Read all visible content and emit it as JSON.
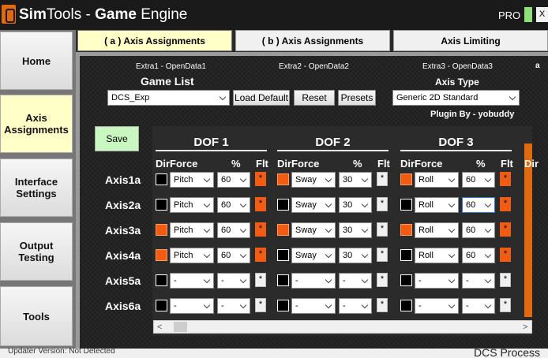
{
  "app": {
    "title_prefix": "Sim",
    "title_mid": "Tools - ",
    "title_bold": "Game",
    "title_suffix": " Engine",
    "pro_label": "PRO",
    "close_label": "X"
  },
  "sidebar": {
    "items": [
      {
        "label": "Home"
      },
      {
        "label": "Axis Assignments"
      },
      {
        "label": "Interface Settings"
      },
      {
        "label": "Output Testing"
      },
      {
        "label": "Tools"
      }
    ]
  },
  "tabs": [
    {
      "label": "( a ) Axis Assignments"
    },
    {
      "label": "( b ) Axis Assignments"
    },
    {
      "label": "Axis Limiting"
    }
  ],
  "extras": {
    "extra1": "Extra1 - OpenData1",
    "extra2": "Extra2 - OpenData2",
    "extra3": "Extra3 - OpenData3",
    "corner": "a"
  },
  "game_list": {
    "label": "Game List",
    "selected": "DCS_Exp",
    "load_default": "Load Default",
    "reset": "Reset",
    "presets": "Presets"
  },
  "axis_type": {
    "label": "Axis Type",
    "selected": "Generic 2D Standard"
  },
  "plugin_by": "Plugin By - yobuddy",
  "save_label": "Save",
  "columns": {
    "dir": "Dir",
    "force": "Force",
    "percent": "%",
    "flt": "Flt"
  },
  "dof": [
    {
      "title": "DOF 1",
      "rows": [
        {
          "dir_on": false,
          "force": "Pitch",
          "percent": "60",
          "flt": "*",
          "flt_on": true
        },
        {
          "dir_on": false,
          "force": "Pitch",
          "percent": "60",
          "flt": "*",
          "flt_on": true
        },
        {
          "dir_on": true,
          "force": "Pitch",
          "percent": "60",
          "flt": "*",
          "flt_on": true
        },
        {
          "dir_on": true,
          "force": "Pitch",
          "percent": "60",
          "flt": "*",
          "flt_on": true
        },
        {
          "dir_on": false,
          "force": "-",
          "percent": "-",
          "flt": "*",
          "flt_on": false
        },
        {
          "dir_on": false,
          "force": "-",
          "percent": "-",
          "flt": "*",
          "flt_on": false
        }
      ]
    },
    {
      "title": "DOF 2",
      "rows": [
        {
          "dir_on": true,
          "force": "Sway",
          "percent": "30",
          "flt": "*",
          "flt_on": false
        },
        {
          "dir_on": false,
          "force": "Sway",
          "percent": "30",
          "flt": "*",
          "flt_on": false
        },
        {
          "dir_on": true,
          "force": "Sway",
          "percent": "30",
          "flt": "*",
          "flt_on": false
        },
        {
          "dir_on": false,
          "force": "Sway",
          "percent": "30",
          "flt": "*",
          "flt_on": false
        },
        {
          "dir_on": false,
          "force": "-",
          "percent": "-",
          "flt": "*",
          "flt_on": false
        },
        {
          "dir_on": false,
          "force": "-",
          "percent": "-",
          "flt": "*",
          "flt_on": false
        }
      ]
    },
    {
      "title": "DOF 3",
      "rows": [
        {
          "dir_on": true,
          "force": "Roll",
          "percent": "60",
          "flt": "*",
          "flt_on": true
        },
        {
          "dir_on": false,
          "force": "Roll",
          "percent": "60",
          "flt": "*",
          "flt_on": true
        },
        {
          "dir_on": true,
          "force": "Roll",
          "percent": "60",
          "flt": "*",
          "flt_on": true
        },
        {
          "dir_on": false,
          "force": "Roll",
          "percent": "60",
          "flt": "*",
          "flt_on": true
        },
        {
          "dir_on": false,
          "force": "-",
          "percent": "-",
          "flt": "*",
          "flt_on": false
        },
        {
          "dir_on": false,
          "force": "-",
          "percent": "-",
          "flt": "*",
          "flt_on": false
        }
      ]
    }
  ],
  "axes": [
    {
      "label": "Axis1a"
    },
    {
      "label": "Axis2a"
    },
    {
      "label": "Axis3a"
    },
    {
      "label": "Axis4a"
    },
    {
      "label": "Axis5a"
    },
    {
      "label": "Axis6a"
    }
  ],
  "scroll": {
    "left_arrow": "<",
    "right_arrow": ">"
  },
  "footer": {
    "left": "Updater Version: Not Detected",
    "right": "DCS Process"
  },
  "colors": {
    "accent": "#f25c12",
    "active_tab": "#ffffc8",
    "save": "#c9f7c0"
  }
}
